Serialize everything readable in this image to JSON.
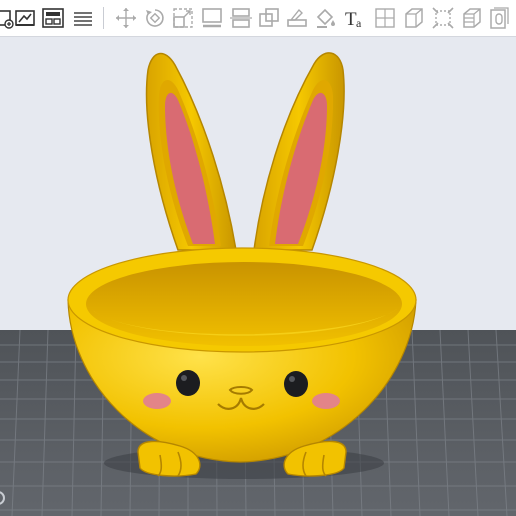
{
  "toolbar": {
    "tools": [
      {
        "icon": "add-object-icon",
        "enabled": true
      },
      {
        "icon": "arrange-icon",
        "enabled": true
      },
      {
        "icon": "layout-icon",
        "enabled": true
      },
      {
        "icon": "layers-icon",
        "enabled": true
      },
      {
        "icon": "move-icon",
        "enabled": false
      },
      {
        "icon": "rotate-icon",
        "enabled": false
      },
      {
        "icon": "scale-icon",
        "enabled": false
      },
      {
        "icon": "lay-on-face-icon",
        "enabled": false
      },
      {
        "icon": "cut-icon",
        "enabled": false
      },
      {
        "icon": "boolean-icon",
        "enabled": false
      },
      {
        "icon": "support-paint-icon",
        "enabled": false
      },
      {
        "icon": "color-paint-icon",
        "enabled": false
      },
      {
        "icon": "text-icon",
        "enabled": true,
        "label": "Ta"
      },
      {
        "icon": "split-objects-icon",
        "enabled": false
      },
      {
        "icon": "split-parts-icon",
        "enabled": false
      },
      {
        "icon": "measure-icon",
        "enabled": false
      },
      {
        "icon": "variable-layer-icon",
        "enabled": false
      },
      {
        "icon": "assembly-icon",
        "enabled": false
      }
    ]
  },
  "colors": {
    "toolbar_bg": "#ffffff",
    "canvas_bg": "#e6e9f0",
    "bed": "#5b5f65",
    "grid_line": "#7e838a",
    "model_yellow": "#f2c200",
    "ear_inner": "#d96b72",
    "blush": "#e38488",
    "eye": "#1c1d20"
  },
  "scene": {
    "object": "bunny bowl",
    "ears": 2,
    "feet": 2
  }
}
